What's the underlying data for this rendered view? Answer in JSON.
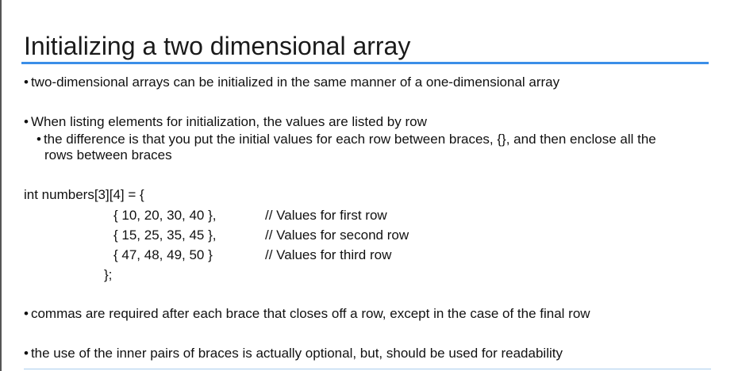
{
  "slide": {
    "title": "Initializing a two dimensional array",
    "bullet_char": "•",
    "bullet1": "two-dimensional arrays can be initialized in the same manner of a one-dimensional array",
    "bullet2": "When listing elements for initialization, the values are listed by row",
    "sub_bullet_line1": "the difference is that you put the initial values for each row between braces, {}, and then enclose all the",
    "sub_bullet_line2": "rows between braces",
    "code": {
      "decl": "int numbers[3][4] = {",
      "rows": [
        {
          "values": "{ 10, 20, 30, 40 },",
          "comment": "// Values for first row"
        },
        {
          "values": "{ 15, 25, 35, 45 },",
          "comment": "// Values for second row"
        },
        {
          "values": "{ 47, 48, 49, 50 }",
          "comment": "// Values for third row"
        }
      ],
      "close": "};"
    },
    "bullet3": "commas are required after each brace that closes off a row, except in the case of the final row",
    "bullet4": "the use of the inner pairs of braces is actually optional, but, should be used for readability"
  }
}
